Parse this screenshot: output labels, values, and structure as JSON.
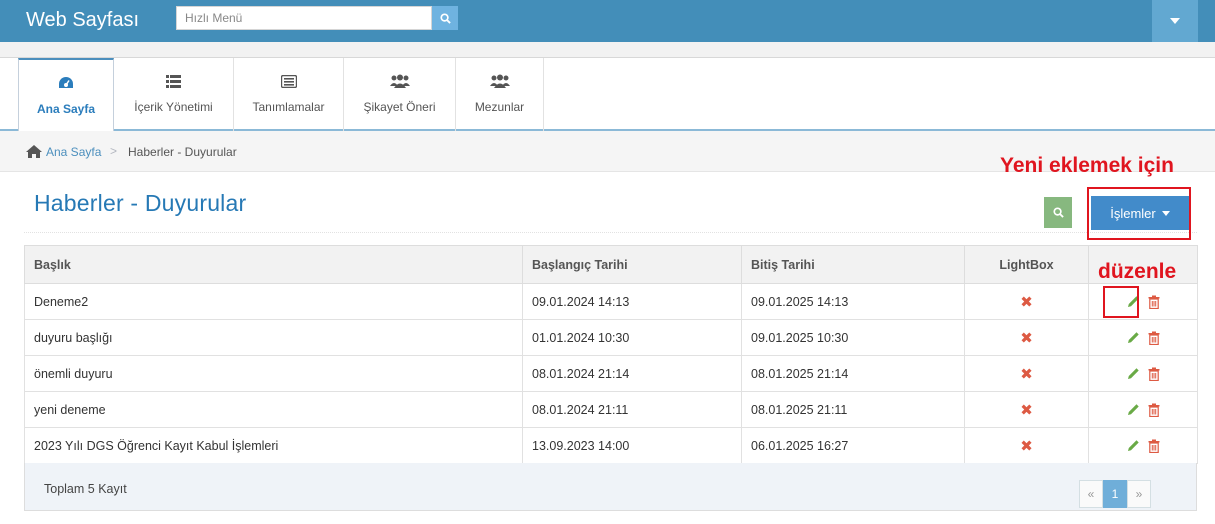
{
  "navbar": {
    "brand": "Web Sayfası",
    "quick_menu_placeholder": "Hızlı Menü",
    "search_icon": "search-icon",
    "user_dropdown_icon": "caret-down-icon",
    "bg_color": "#438eb9"
  },
  "menu": {
    "items": [
      {
        "label": "Ana Sayfa",
        "icon": "dashboard-icon",
        "active": true
      },
      {
        "label": "İçerik Yönetimi",
        "icon": "list-icon"
      },
      {
        "label": "Tanımlamalar",
        "icon": "list-alt-icon"
      },
      {
        "label": "Şikayet Öneri",
        "icon": "users-icon"
      },
      {
        "label": "Mezunlar",
        "icon": "users-icon"
      }
    ]
  },
  "breadcrumb": {
    "home": "Ana Sayfa",
    "separator": ">",
    "current": "Haberler - Duyurular"
  },
  "page": {
    "title": "Haberler - Duyurular",
    "actions_button": "İşlemler",
    "accent_color": "#428bca",
    "search_button_color": "#87b87f"
  },
  "annotations": {
    "add_new": "Yeni eklemek için",
    "edit": "düzenle",
    "color": "#e0151f"
  },
  "table": {
    "headers": {
      "title": "Başlık",
      "start": "Başlangıç Tarihi",
      "end": "Bitiş Tarihi",
      "lightbox": "LightBox"
    },
    "rows": [
      {
        "title": "Deneme2",
        "start": "09.01.2024 14:13",
        "end": "09.01.2025 14:13",
        "lightbox": "✖"
      },
      {
        "title": "duyuru başlığı",
        "start": "01.01.2024 10:30",
        "end": "09.01.2025 10:30",
        "lightbox": "✖"
      },
      {
        "title": "önemli duyuru",
        "start": "08.01.2024 21:14",
        "end": "08.01.2025 21:14",
        "lightbox": "✖"
      },
      {
        "title": "yeni deneme",
        "start": "08.01.2024 21:11",
        "end": "08.01.2025 21:11",
        "lightbox": "✖"
      },
      {
        "title": "2023 Yılı DGS Öğrenci Kayıt Kabul İşlemleri",
        "start": "13.09.2023 14:00",
        "end": "06.01.2025 16:27",
        "lightbox": "✖"
      }
    ],
    "row_actions": [
      "pencil-icon",
      "trash-icon"
    ]
  },
  "footer": {
    "total": "Toplam 5 Kayıt",
    "pager_prev": "«",
    "pager_current": "1",
    "pager_next": "»"
  }
}
